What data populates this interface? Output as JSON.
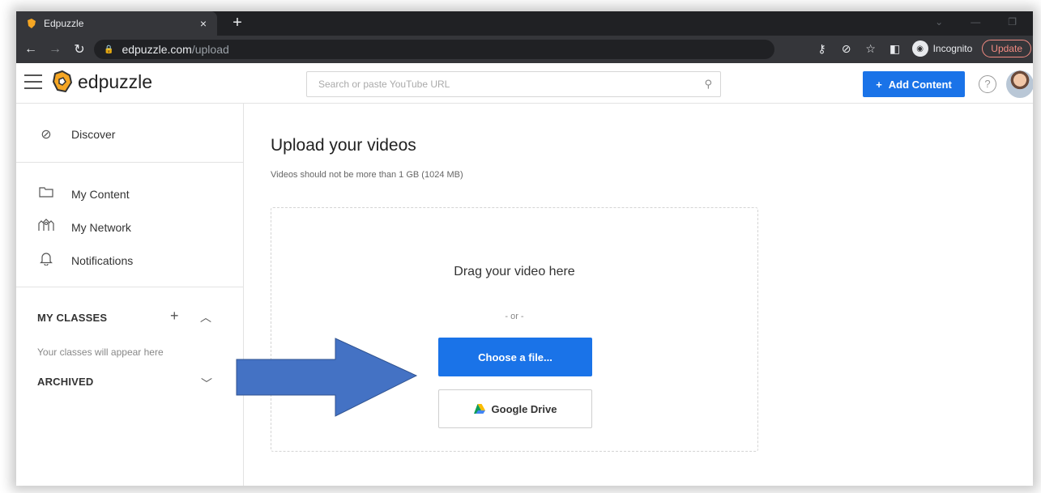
{
  "browser": {
    "tab_title": "Edpuzzle",
    "tab_close": "×",
    "new_tab": "+",
    "url_host": "edpuzzle.com",
    "url_path": "/upload",
    "incognito_label": "Incognito",
    "update_label": "Update"
  },
  "header": {
    "logo_text": "edpuzzle",
    "search_placeholder": "Search or paste YouTube URL",
    "add_content_label": "Add Content",
    "add_content_icon": "+",
    "help_icon": "?"
  },
  "sidebar": {
    "nav": [
      {
        "label": "Discover",
        "icon": "compass-icon"
      },
      {
        "label": "My Content",
        "icon": "folder-icon"
      },
      {
        "label": "My Network",
        "icon": "network-icon"
      },
      {
        "label": "Notifications",
        "icon": "bell-icon"
      }
    ],
    "my_classes_title": "MY CLASSES",
    "my_classes_empty": "Your classes will appear here",
    "archived_title": "ARCHIVED"
  },
  "main": {
    "title": "Upload your videos",
    "subtitle": "Videos should not be more than 1 GB (1024 MB)",
    "drag_text": "Drag your video here",
    "or_text": "- or -",
    "choose_file_label": "Choose a file...",
    "google_drive_label": "Google Drive"
  },
  "colors": {
    "primary": "#1a73e8",
    "annotation_arrow": "#4472c4",
    "logo_orange": "#f5a623"
  }
}
